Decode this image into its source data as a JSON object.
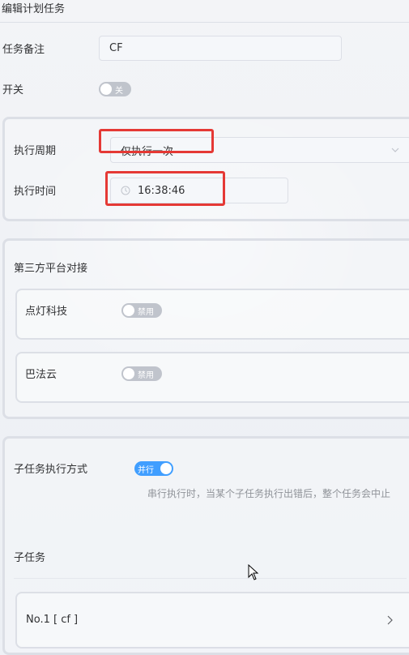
{
  "title": "编辑计划任务",
  "note": {
    "label": "任务备注",
    "value": "CF"
  },
  "switch": {
    "label": "开关",
    "state": "关"
  },
  "schedule": {
    "period_label": "执行周期",
    "period_value": "仅执行一次",
    "time_label": "执行时间",
    "time_value": "16:38:46"
  },
  "third_party": {
    "title": "第三方平台对接",
    "items": [
      {
        "name": "点灯科技",
        "state": "禁用"
      },
      {
        "name": "巴法云",
        "state": "禁用"
      }
    ]
  },
  "subtask": {
    "mode_label": "子任务执行方式",
    "mode_state": "并行",
    "hint": "串行执行时，当某个子任务执行出错后，整个任务会中止",
    "list_title": "子任务",
    "items": [
      {
        "label": "No.1 [ cf ]"
      }
    ]
  },
  "colors": {
    "accent": "#409eff",
    "highlight": "#e53935",
    "switch_off": "#c0c4cc"
  },
  "icons": {
    "clock": "clock-icon",
    "dropdown": "chevron-down-icon",
    "item_arrow": "chevron-right-icon"
  }
}
